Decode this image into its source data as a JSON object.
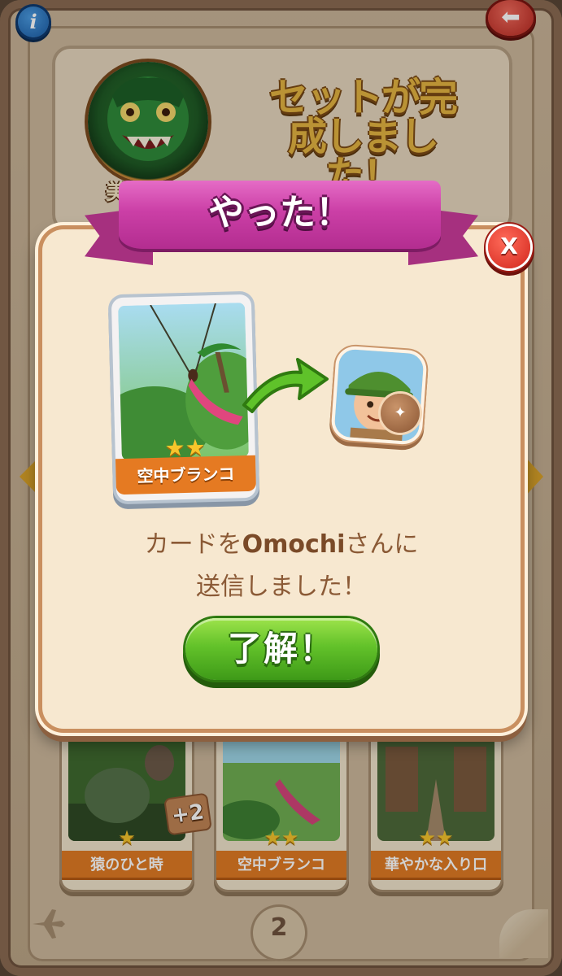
{
  "background": {
    "info_glyph": "i",
    "back_glyph": "⬅",
    "set_title_lines": [
      "セットが完",
      "成しまし",
      "た！"
    ],
    "medal_label": "美",
    "cards": [
      {
        "name": "猿のひと時",
        "stars": "★"
      },
      {
        "name": "空中ブランコ",
        "stars": "★★"
      },
      {
        "name": "華やかな入り口",
        "stars": "★★"
      }
    ],
    "duplicate_count": "+2",
    "page_number": "2"
  },
  "dialog": {
    "title": "やった！",
    "close_glyph": "X",
    "sent_card": {
      "name": "空中ブランコ",
      "stars": "★★"
    },
    "message_prefix": "カードを",
    "recipient": "Omochi",
    "message_suffix": "さんに",
    "message_line2": "送信しました！",
    "ok_label": "了解！"
  },
  "colors": {
    "ribbon": "#cb3fa6",
    "ok_button": "#63c22a",
    "close_button": "#d2261c",
    "card_label": "#e57a22",
    "message_text": "#8b5a36"
  }
}
